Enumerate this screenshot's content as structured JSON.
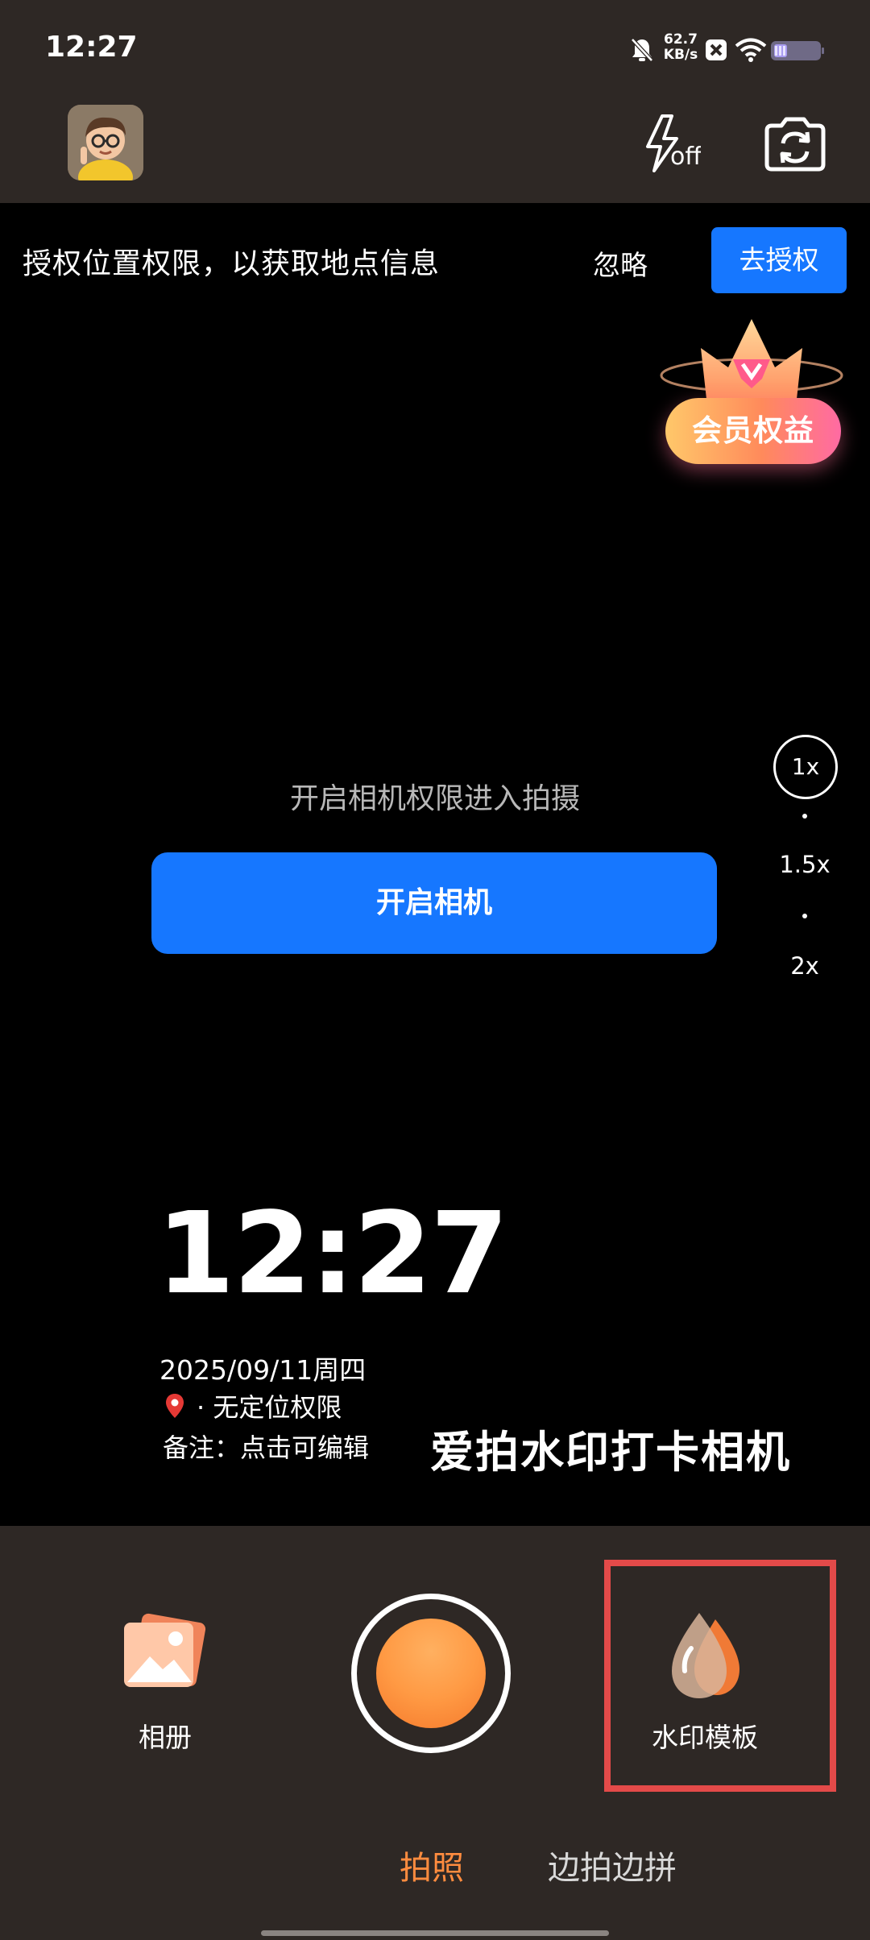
{
  "status_bar": {
    "time": "12:27",
    "net_speed_value": "62.7",
    "net_speed_unit": "KB/s",
    "icons": [
      "bell-off-icon",
      "notification-x-icon",
      "wifi-icon",
      "battery-icon"
    ]
  },
  "toolbar": {
    "avatar": "avatar",
    "flash_icon": "flash-off-icon",
    "flip_icon": "camera-switch-icon"
  },
  "permission_banner": {
    "message": "授权位置权限，以获取地点信息",
    "ignore_label": "忽略",
    "authorize_label": "去授权"
  },
  "vip": {
    "label": "会员权益"
  },
  "zoom": {
    "options": [
      "1x",
      "1.5x",
      "2x"
    ],
    "selected": "1x"
  },
  "camera": {
    "hint": "开启相机权限进入拍摄",
    "open_button": "开启相机"
  },
  "watermark": {
    "time": "12:27",
    "date": "2025/09/11周四",
    "location": "· 无定位权限",
    "note": "备注：点击可编辑",
    "brand": "爱拍水印打卡相机"
  },
  "bottom": {
    "album_label": "相册",
    "template_label": "水印模板",
    "tabs": [
      "拍照",
      "边拍边拼"
    ],
    "active_tab": "拍照"
  },
  "colors": {
    "accent_blue": "#1677ff",
    "shutter_orange": "#ff9a44",
    "active_tab": "#ff8c3f",
    "highlight_red": "#e34a49"
  }
}
